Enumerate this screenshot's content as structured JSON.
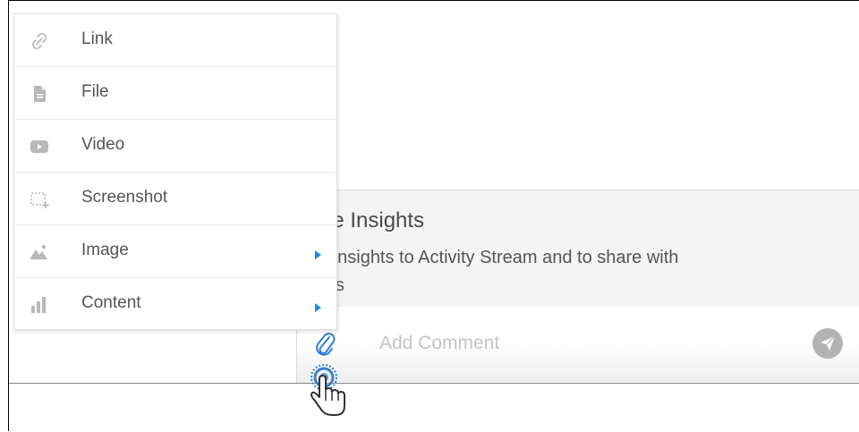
{
  "attach_menu": {
    "items": [
      {
        "label": "Link",
        "icon": "link-icon",
        "has_submenu": false
      },
      {
        "label": "File",
        "icon": "file-icon",
        "has_submenu": false
      },
      {
        "label": "Video",
        "icon": "video-icon",
        "has_submenu": false
      },
      {
        "label": "Screenshot",
        "icon": "screenshot-icon",
        "has_submenu": false
      },
      {
        "label": "Image",
        "icon": "image-icon",
        "has_submenu": true
      },
      {
        "label": "Content",
        "icon": "content-chart-icon",
        "has_submenu": true
      }
    ],
    "submenu_arrow_color": "#1e88e5"
  },
  "insights_panel": {
    "title": "ave Insights",
    "description": "ve insights to Activity Stream and to share with\nners"
  },
  "comment": {
    "placeholder": "Add Comment",
    "value": "",
    "attach_icon": "paperclip-icon",
    "send_icon": "send-plane-icon"
  },
  "colors": {
    "accent": "#2f7fd8",
    "icon_gray": "#b8b8b8",
    "text": "#555555"
  }
}
